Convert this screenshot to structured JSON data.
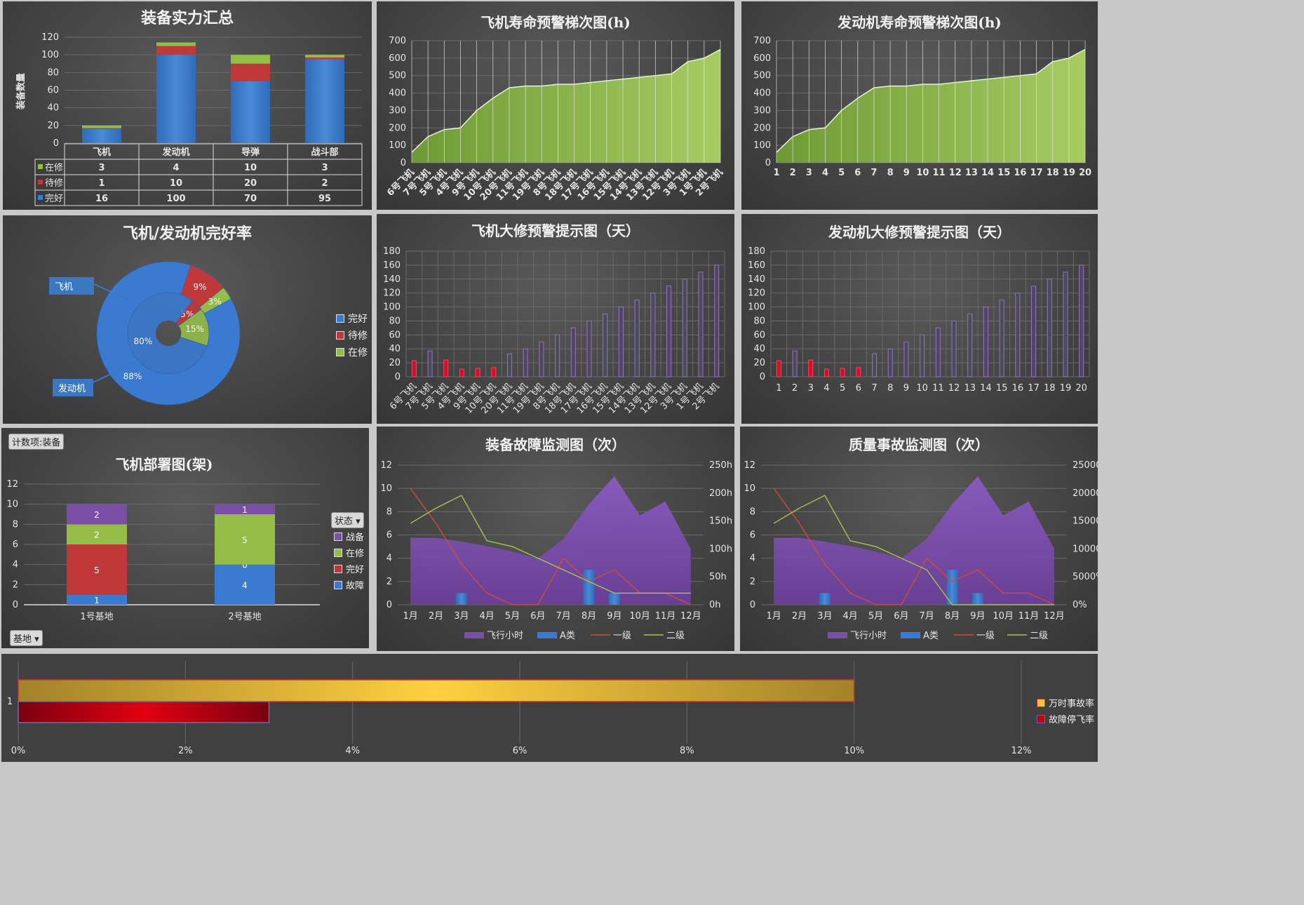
{
  "colors": {
    "blue": "#3a7ad0",
    "red": "#c0383a",
    "green": "#94bd48",
    "purple": "#7b4fa8",
    "lightgreen": "#9bc35a",
    "gold": "#f6c53d",
    "darkred": "#c00010"
  },
  "chart_data": [
    {
      "id": "summary",
      "type": "bar",
      "stacked": true,
      "title": "装备实力汇总",
      "ylabel": "装备数量",
      "ylim": [
        0,
        120
      ],
      "yticks": [
        "120",
        "100",
        "80",
        "60",
        "40",
        "20",
        "0"
      ],
      "categories": [
        "飞机",
        "发动机",
        "导弹",
        "战斗部"
      ],
      "series": [
        {
          "name": "完好",
          "values": [
            16,
            100,
            70,
            95
          ]
        },
        {
          "name": "待修",
          "values": [
            1,
            10,
            20,
            2
          ]
        },
        {
          "name": "在修",
          "values": [
            3,
            4,
            10,
            3
          ]
        }
      ],
      "table_rows": [
        {
          "label": "在修",
          "values": [
            "3",
            "4",
            "10",
            "3"
          ]
        },
        {
          "label": "待修",
          "values": [
            "1",
            "10",
            "20",
            "2"
          ]
        },
        {
          "label": "完好",
          "values": [
            "16",
            "100",
            "70",
            "95"
          ]
        }
      ]
    },
    {
      "id": "aircraft_life",
      "type": "area",
      "title": "飞机寿命预警梯次图(h)",
      "ylim": [
        0,
        700
      ],
      "yticks": [
        "700",
        "600",
        "500",
        "400",
        "300",
        "200",
        "100",
        "0"
      ],
      "categories": [
        "6号飞机",
        "7号飞机",
        "5号飞机",
        "4号飞机",
        "9号飞机",
        "10号飞机",
        "20号飞机",
        "11号飞机",
        "19号飞机",
        "8号飞机",
        "18号飞机",
        "17号飞机",
        "16号飞机",
        "15号飞机",
        "14号飞机",
        "13号飞机",
        "12号飞机",
        "3号飞机",
        "1号飞机",
        "2号飞机"
      ],
      "values": [
        60,
        150,
        190,
        200,
        300,
        370,
        430,
        440,
        440,
        450,
        450,
        460,
        470,
        480,
        490,
        500,
        510,
        580,
        600,
        650
      ]
    },
    {
      "id": "engine_life",
      "type": "area",
      "title": "发动机寿命预警梯次图(h)",
      "ylim": [
        0,
        700
      ],
      "yticks": [
        "700",
        "600",
        "500",
        "400",
        "300",
        "200",
        "100",
        "0"
      ],
      "categories": [
        "1",
        "2",
        "3",
        "4",
        "5",
        "6",
        "7",
        "8",
        "9",
        "10",
        "11",
        "12",
        "13",
        "14",
        "15",
        "16",
        "17",
        "18",
        "19",
        "20"
      ],
      "values": [
        60,
        150,
        190,
        200,
        300,
        370,
        430,
        440,
        440,
        450,
        450,
        460,
        470,
        480,
        490,
        500,
        510,
        580,
        600,
        650
      ]
    },
    {
      "id": "donut",
      "type": "pie",
      "title": "飞机/发动机完好率",
      "legend": [
        "完好",
        "待修",
        "在修"
      ],
      "rings": [
        {
          "name": "飞机",
          "values": [
            88,
            9,
            3
          ],
          "labels": [
            "88%",
            "9%",
            "3%"
          ]
        },
        {
          "name": "发动机",
          "values": [
            80,
            5,
            15
          ],
          "labels": [
            "80%",
            "5%",
            "15%"
          ]
        }
      ],
      "callouts": [
        "飞机",
        "发动机"
      ]
    },
    {
      "id": "aircraft_overhaul",
      "type": "bar",
      "title": "飞机大修预警提示图（天）",
      "ylim": [
        0,
        180
      ],
      "yticks": [
        "180",
        "160",
        "140",
        "120",
        "100",
        "80",
        "60",
        "40",
        "20",
        "0"
      ],
      "categories": [
        "6号飞机",
        "7号飞机",
        "5号飞机",
        "4号飞机",
        "9号飞机",
        "10号飞机",
        "20号飞机",
        "11号飞机",
        "19号飞机",
        "8号飞机",
        "18号飞机",
        "17号飞机",
        "16号飞机",
        "15号飞机",
        "14号飞机",
        "13号飞机",
        "12号飞机",
        "3号飞机",
        "1号飞机",
        "2号飞机"
      ],
      "values": [
        23,
        37,
        24,
        11,
        12,
        13,
        33,
        40,
        50,
        60,
        70,
        80,
        90,
        100,
        110,
        120,
        130,
        140,
        150,
        160
      ],
      "warning_threshold": 30
    },
    {
      "id": "engine_overhaul",
      "type": "bar",
      "title": "发动机大修预警提示图（天）",
      "ylim": [
        0,
        180
      ],
      "yticks": [
        "180",
        "160",
        "140",
        "120",
        "100",
        "80",
        "60",
        "40",
        "20",
        "0"
      ],
      "categories": [
        "1",
        "2",
        "3",
        "4",
        "5",
        "6",
        "7",
        "8",
        "9",
        "10",
        "11",
        "12",
        "13",
        "14",
        "15",
        "16",
        "17",
        "18",
        "19",
        "20"
      ],
      "values": [
        23,
        37,
        24,
        11,
        12,
        13,
        33,
        40,
        50,
        60,
        70,
        80,
        90,
        100,
        110,
        120,
        130,
        140,
        150,
        160
      ],
      "warning_threshold": 30
    },
    {
      "id": "deployment",
      "type": "bar",
      "stacked": true,
      "title": "飞机部署图(架)",
      "ylim": [
        0,
        12
      ],
      "yticks": [
        "12",
        "10",
        "8",
        "6",
        "4",
        "2",
        "0"
      ],
      "categories": [
        "1号基地",
        "2号基地"
      ],
      "series": [
        {
          "name": "故障",
          "values": [
            1,
            4
          ],
          "labels": [
            "1",
            "4"
          ]
        },
        {
          "name": "完好",
          "values": [
            5,
            0
          ],
          "labels": [
            "5",
            "0"
          ]
        },
        {
          "name": "在修",
          "values": [
            2,
            5
          ],
          "labels": [
            "2",
            "5"
          ]
        },
        {
          "name": "战备",
          "values": [
            2,
            1
          ],
          "labels": [
            "2",
            "1"
          ]
        }
      ],
      "legend": [
        "战备",
        "在修",
        "完好",
        "故障"
      ],
      "buttons": {
        "count": "计数项:装备",
        "state": "状态",
        "base": "基地"
      }
    },
    {
      "id": "fault_monitor",
      "type": "area",
      "title": "装备故障监测图（次）",
      "ylim": [
        0,
        12
      ],
      "yticks": [
        "12",
        "10",
        "8",
        "6",
        "4",
        "2",
        "0"
      ],
      "y2lim": [
        0,
        250
      ],
      "y2ticks": [
        "250h",
        "200h",
        "150h",
        "100h",
        "50h",
        "0h"
      ],
      "categories": [
        "1月",
        "2月",
        "3月",
        "4月",
        "5月",
        "6月",
        "7月",
        "8月",
        "9月",
        "10月",
        "11月",
        "12月"
      ],
      "series": [
        {
          "name": "飞行小时",
          "type": "area",
          "axis": "y2",
          "values": [
            120,
            120,
            113,
            105,
            95,
            83,
            118,
            180,
            230,
            160,
            185,
            100
          ]
        },
        {
          "name": "A类",
          "type": "bar",
          "values": [
            0,
            0,
            1,
            0,
            0,
            0,
            0,
            3,
            1,
            0,
            0,
            0
          ]
        },
        {
          "name": "一级",
          "type": "line",
          "values": [
            10,
            7,
            3.5,
            1,
            0,
            0,
            4,
            2,
            3,
            1,
            1,
            0
          ]
        },
        {
          "name": "二级",
          "type": "line",
          "values": [
            7,
            8.3,
            9.4,
            5.5,
            5,
            4,
            3,
            2,
            1,
            1,
            1,
            1
          ]
        }
      ]
    },
    {
      "id": "quality_monitor",
      "type": "area",
      "title": "质量事故监测图（次）",
      "ylim": [
        0,
        12
      ],
      "yticks": [
        "12",
        "10",
        "8",
        "6",
        "4",
        "2",
        "0"
      ],
      "y2lim": [
        0,
        25000
      ],
      "y2ticks": [
        "25000%",
        "20000%",
        "15000%",
        "10000%",
        "5000%",
        "0%"
      ],
      "categories": [
        "1月",
        "2月",
        "3月",
        "4月",
        "5月",
        "6月",
        "7月",
        "8月",
        "9月",
        "10月",
        "11月",
        "12月"
      ],
      "series": [
        {
          "name": "飞行小时",
          "type": "area",
          "axis": "y2",
          "values": [
            12000,
            12000,
            11300,
            10500,
            9500,
            8300,
            11800,
            18000,
            23000,
            16000,
            18500,
            10000
          ]
        },
        {
          "name": "A类",
          "type": "bar",
          "values": [
            0,
            0,
            1,
            0,
            0,
            0,
            0,
            3,
            1,
            0,
            0,
            0
          ]
        },
        {
          "name": "一级",
          "type": "line",
          "values": [
            10,
            7,
            3.5,
            1,
            0,
            0,
            4,
            2,
            3,
            1,
            1,
            0
          ]
        },
        {
          "name": "二级",
          "type": "line",
          "values": [
            7,
            8.3,
            9.4,
            5.5,
            5,
            4,
            3,
            0,
            0,
            0,
            0,
            0
          ]
        }
      ]
    },
    {
      "id": "rates",
      "type": "bar",
      "orientation": "horizontal",
      "category": "1",
      "xlim": [
        0,
        12
      ],
      "xticks": [
        "0%",
        "2%",
        "4%",
        "6%",
        "8%",
        "10%",
        "12%"
      ],
      "series": [
        {
          "name": "万时事故率",
          "value": 10
        },
        {
          "name": "故障停飞率",
          "value": 3
        }
      ]
    }
  ]
}
